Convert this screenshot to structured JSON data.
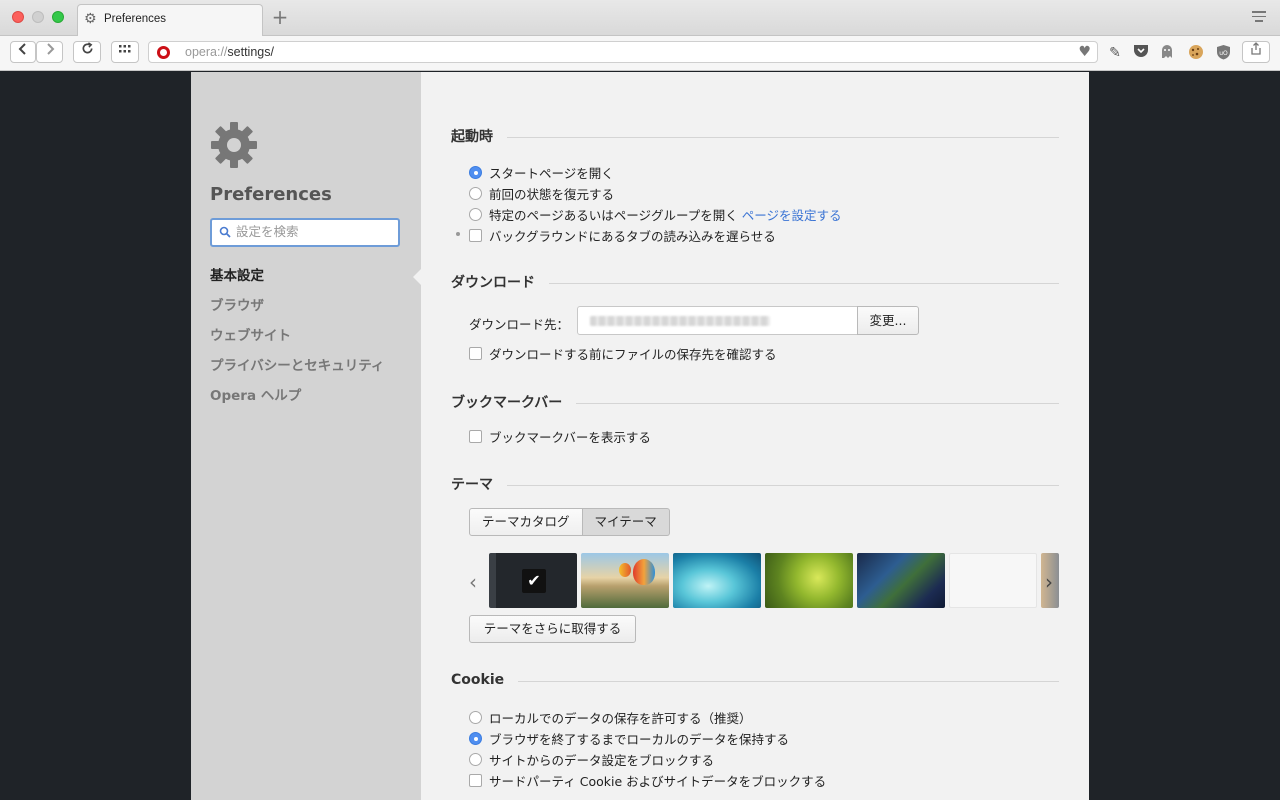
{
  "browser": {
    "tab_title": "Preferences",
    "url_scheme": "opera://",
    "url_path": "settings/"
  },
  "sidebar": {
    "title": "Preferences",
    "search_placeholder": "設定を検索",
    "items": [
      {
        "label": "基本設定",
        "active": true
      },
      {
        "label": "ブラウザ"
      },
      {
        "label": "ウェブサイト"
      },
      {
        "label": "プライバシーとセキュリティ"
      },
      {
        "label": "Opera ヘルプ"
      }
    ]
  },
  "startup": {
    "title": "起動時",
    "options": [
      "スタートページを開く",
      "前回の状態を復元する",
      "特定のページあるいはページグループを開く"
    ],
    "set_pages_link": "ページを設定する",
    "delay_tabs": "バックグラウンドにあるタブの読み込みを遅らせる",
    "selected": 0
  },
  "download": {
    "title": "ダウンロード",
    "location_label": "ダウンロード先：",
    "change_button": "変更...",
    "ask_location": "ダウンロードする前にファイルの保存先を確認する"
  },
  "bookmarks_bar": {
    "title": "ブックマークバー",
    "show": "ブックマークバーを表示する"
  },
  "theme": {
    "title": "テーマ",
    "tabs": [
      "テーマカタログ",
      "マイテーマ"
    ],
    "selected_tab": 1,
    "get_more": "テーマをさらに取得する"
  },
  "cookie": {
    "title": "Cookie",
    "options": [
      "ローカルでのデータの保存を許可する（推奨）",
      "ブラウザを終了するまでローカルのデータを保持する",
      "サイトからのデータ設定をブロックする"
    ],
    "selected": 1,
    "third_party": "サードパーティ Cookie およびサイトデータをブロックする"
  }
}
